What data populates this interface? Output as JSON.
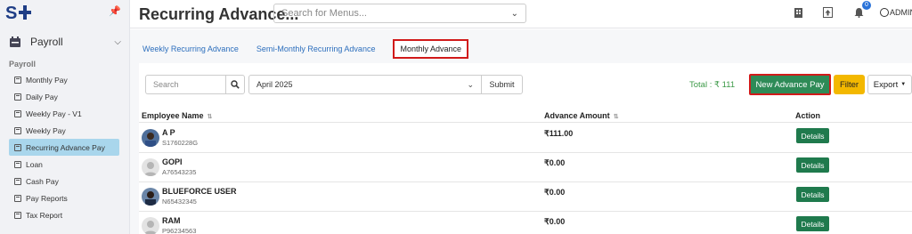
{
  "app": {
    "title": "Recurring Advance..."
  },
  "header": {
    "search_placeholder": "Search for Menus...",
    "notification_count": "0",
    "user_label": "ADMIN"
  },
  "sidebar": {
    "module_label": "Payroll",
    "section_label": "Payroll",
    "items": [
      {
        "label": "Monthly Pay"
      },
      {
        "label": "Daily Pay"
      },
      {
        "label": "Weekly Pay - V1"
      },
      {
        "label": "Weekly Pay"
      },
      {
        "label": "Recurring Advance Pay",
        "active": true
      },
      {
        "label": "Loan"
      },
      {
        "label": "Cash Pay"
      },
      {
        "label": "Pay Reports"
      },
      {
        "label": "Tax Report"
      }
    ]
  },
  "tabs": [
    {
      "label": "Weekly Recurring Advance"
    },
    {
      "label": "Semi-Monthly Recurring Advance"
    },
    {
      "label": "Monthly Advance",
      "active": true
    }
  ],
  "toolbar": {
    "search_placeholder": "Search",
    "month_value": "April 2025",
    "submit_label": "Submit",
    "total_label": "Total : ₹ 111",
    "new_button_label": "New Advance Pay",
    "filter_label": "Filter",
    "export_label": "Export"
  },
  "table": {
    "columns": [
      "Employee Name",
      "Advance Amount",
      "Action"
    ],
    "rows": [
      {
        "name": "A P",
        "id": "S1760228G",
        "amount": "₹111.00",
        "action": "Details",
        "avatar": "photo"
      },
      {
        "name": "GOPI",
        "id": "A76543235",
        "amount": "₹0.00",
        "action": "Details",
        "avatar": "placeholder"
      },
      {
        "name": "BLUEFORCE USER",
        "id": "N65432345",
        "amount": "₹0.00",
        "action": "Details",
        "avatar": "photo"
      },
      {
        "name": "RAM",
        "id": "P96234563",
        "amount": "₹0.00",
        "action": "Details",
        "avatar": "placeholder"
      }
    ]
  },
  "colors": {
    "accent_green": "#2e8b57",
    "details_green": "#1f7a4d",
    "filter_yellow": "#f3b800",
    "active_item": "#a9d6ec",
    "highlight_red": "#d11a1a",
    "link_blue": "#2d6fbd"
  }
}
